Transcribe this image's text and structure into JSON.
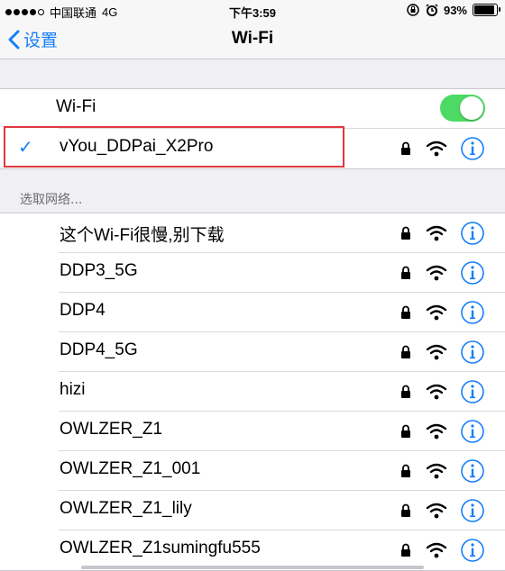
{
  "status_bar": {
    "signal_dots_filled": 4,
    "signal_dots_total": 5,
    "carrier": "中国联通",
    "network": "4G",
    "time": "下午3:59",
    "battery": "93%",
    "battery_level": 0.93
  },
  "nav": {
    "back_label": "设置",
    "title": "Wi-Fi"
  },
  "wifi_toggle": {
    "label": "Wi-Fi",
    "on": true
  },
  "connected": {
    "name": "vYou_DDPai_X2Pro"
  },
  "section_header": "选取网络...",
  "networks": [
    {
      "name": "这个Wi-Fi很慢,别下载"
    },
    {
      "name": "DDP3_5G"
    },
    {
      "name": "DDP4"
    },
    {
      "name": "DDP4_5G"
    },
    {
      "name": "hizi"
    },
    {
      "name": "OWLZER_Z1"
    },
    {
      "name": "OWLZER_Z1_001"
    },
    {
      "name": "OWLZER_Z1_lily"
    },
    {
      "name": "OWLZER_Z1sumingfu555"
    }
  ],
  "colors": {
    "accent": "#157efb",
    "toggle_on": "#4cd964",
    "highlight": "#e0383e",
    "background": "#efeff4"
  },
  "icons": {
    "lock": "lock-icon",
    "wifi": "wifi-icon",
    "info": "info-icon",
    "check": "checkmark-icon",
    "back": "chevron-left-icon"
  }
}
